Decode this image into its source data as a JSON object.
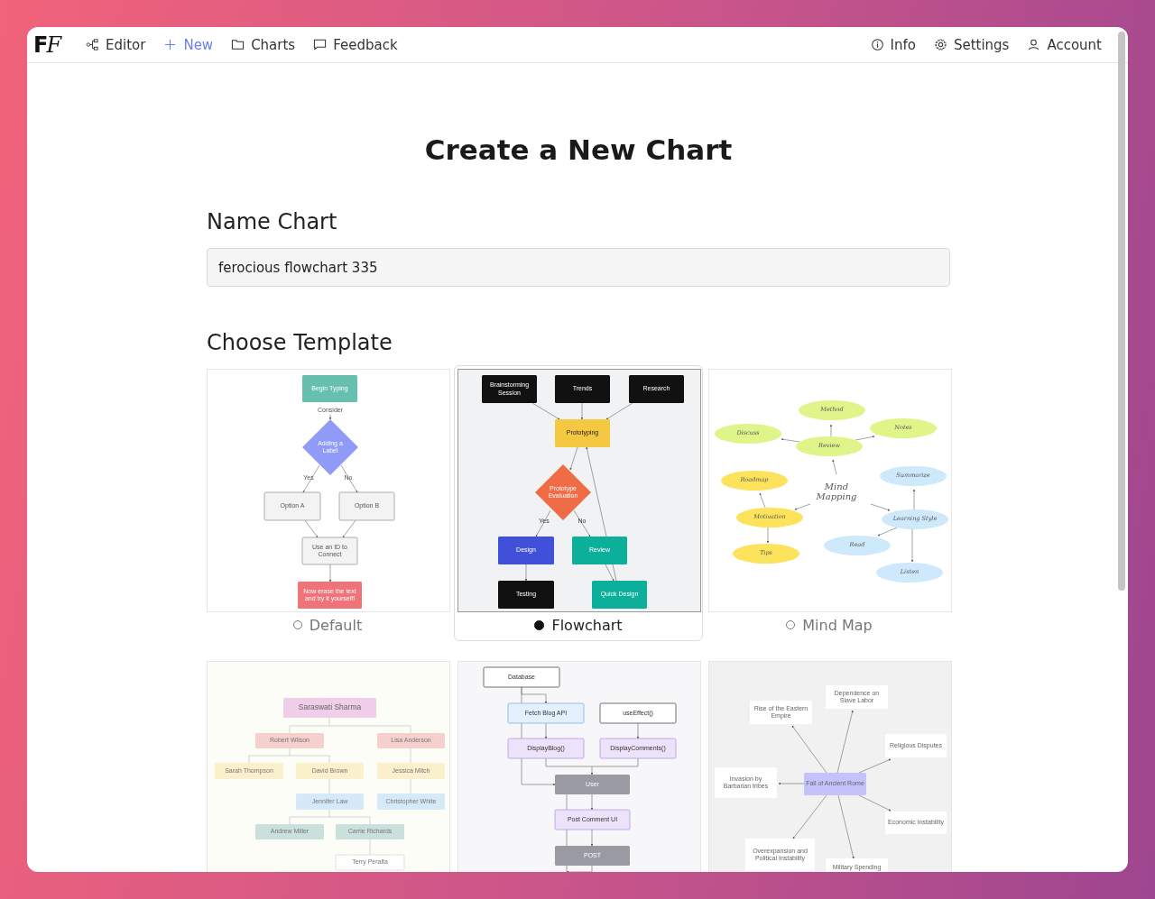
{
  "logo": "FF",
  "nav_left": [
    {
      "label": "Editor",
      "selected": false
    },
    {
      "label": "New",
      "selected": true
    },
    {
      "label": "Charts",
      "selected": false
    },
    {
      "label": "Feedback",
      "selected": false
    }
  ],
  "nav_right": [
    {
      "label": "Info"
    },
    {
      "label": "Settings"
    },
    {
      "label": "Account"
    }
  ],
  "title": "Create a New Chart",
  "name_label": "Name Chart",
  "name_field": {
    "value": "ferocious flowchart 335"
  },
  "template_label": "Choose Template",
  "templates": [
    {
      "name": "Default",
      "selected": false,
      "nodes": [
        "Begin Typing",
        "Consider",
        "Adding a Label",
        "Yes",
        "No",
        "Option A",
        "Option B",
        "Use an ID to Connect",
        "Now erase the text and try it yourself!"
      ]
    },
    {
      "name": "Flowchart",
      "selected": true,
      "nodes": [
        "Brainstorming Session",
        "Trends",
        "Research",
        "Prototyping",
        "Prototype Evaluation",
        "Yes",
        "No",
        "Design",
        "Review",
        "Testing",
        "Quick Design"
      ]
    },
    {
      "name": "Mind Map",
      "selected": false,
      "nodes": [
        "Method",
        "Discuss",
        "Review",
        "Notes",
        "Mind Mapping",
        "Roadmap",
        "Motivation",
        "Tips",
        "Summarize",
        "Learning Style",
        "Read",
        "Listen"
      ]
    },
    {
      "nodes": [
        "Saraswati Sharma",
        "Robert Wilson",
        "Lisa Anderson",
        "Sarah Thompson",
        "David Brown",
        "Jessica Mitch",
        "Jennifer Law",
        "Christopher White",
        "Andrew Miller",
        "Carrie Richards",
        "Terry Peralta"
      ]
    },
    {
      "nodes": [
        "Database",
        "Fetch Blog API",
        "useEffect()",
        "DisplayBlog()",
        "DisplayComments()",
        "User",
        "Post Comment UI",
        "POST"
      ]
    },
    {
      "nodes": [
        "Rise of the Eastern Empire",
        "Dependence on Slave Labor",
        "Religious Disputes",
        "Invasion by Barbarian tribes",
        "Fall of Ancient Rome",
        "Economic Instability",
        "Overexpansion and Political Instability",
        "Military Spending"
      ]
    }
  ]
}
